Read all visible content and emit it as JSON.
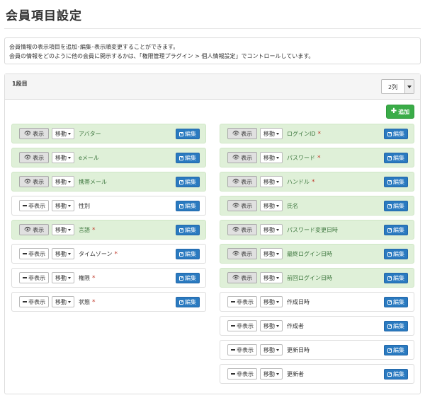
{
  "page": {
    "title": "会員項目設定"
  },
  "info": {
    "line1": "会員情報の表示項目を追加･編集･表示順変更することができます。",
    "line2": "会員の情報をどのように他の会員に開示するかは、「権限管理プラグイン > 個人情報設定」でコントロールしています。"
  },
  "panel": {
    "row_label": "1段目",
    "columns_select": "2列",
    "add_label": "追加"
  },
  "labels": {
    "show": "表示",
    "hide": "非表示",
    "move": "移動",
    "edit": "編集",
    "required_mark": "*"
  },
  "left_fields": [
    {
      "name": "アバター",
      "shown": true,
      "required": false
    },
    {
      "name": "eメール",
      "shown": true,
      "required": false
    },
    {
      "name": "携帯メール",
      "shown": true,
      "required": false
    },
    {
      "name": "性別",
      "shown": false,
      "required": false
    },
    {
      "name": "言語",
      "shown": true,
      "required": true
    },
    {
      "name": "タイムゾーン",
      "shown": false,
      "required": true
    },
    {
      "name": "権限",
      "shown": false,
      "required": true
    },
    {
      "name": "状態",
      "shown": false,
      "required": true
    }
  ],
  "right_fields": [
    {
      "name": "ログインID",
      "shown": true,
      "required": true
    },
    {
      "name": "パスワード",
      "shown": true,
      "required": true
    },
    {
      "name": "ハンドル",
      "shown": true,
      "required": true
    },
    {
      "name": "氏名",
      "shown": true,
      "required": false
    },
    {
      "name": "パスワード変更日時",
      "shown": true,
      "required": false
    },
    {
      "name": "最終ログイン日時",
      "shown": true,
      "required": false
    },
    {
      "name": "前回ログイン日時",
      "shown": true,
      "required": false
    },
    {
      "name": "作成日時",
      "shown": false,
      "required": false
    },
    {
      "name": "作成者",
      "shown": false,
      "required": false
    },
    {
      "name": "更新日時",
      "shown": false,
      "required": false
    },
    {
      "name": "更新者",
      "shown": false,
      "required": false
    }
  ]
}
